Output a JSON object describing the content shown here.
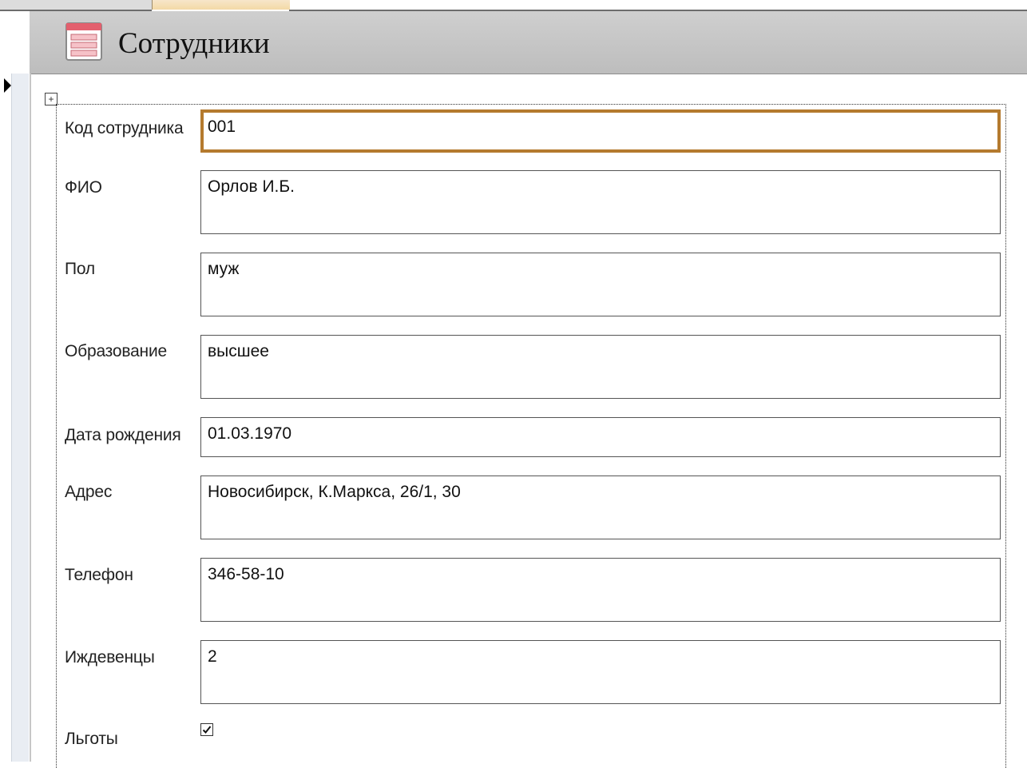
{
  "form": {
    "title": "Сотрудники",
    "icon": "form-icon"
  },
  "fields": [
    {
      "label": "Код сотрудника",
      "value": "001"
    },
    {
      "label": "ФИО",
      "value": "Орлов И.Б."
    },
    {
      "label": "Пол",
      "value": "муж"
    },
    {
      "label": "Образование",
      "value": "высшее"
    },
    {
      "label": "Дата рождения",
      "value": "01.03.1970"
    },
    {
      "label": "Адрес",
      "value": "Новосибирск, К.Маркса, 26/1, 30"
    },
    {
      "label": "Телефон",
      "value": "346-58-10"
    },
    {
      "label": "Иждевенцы",
      "value": "2"
    },
    {
      "label": "Льготы",
      "checked": true
    }
  ],
  "colors": {
    "active_field_border": "#b47a2e",
    "header_background": "#c6c6c6",
    "active_tab": "#f3d9a6"
  }
}
